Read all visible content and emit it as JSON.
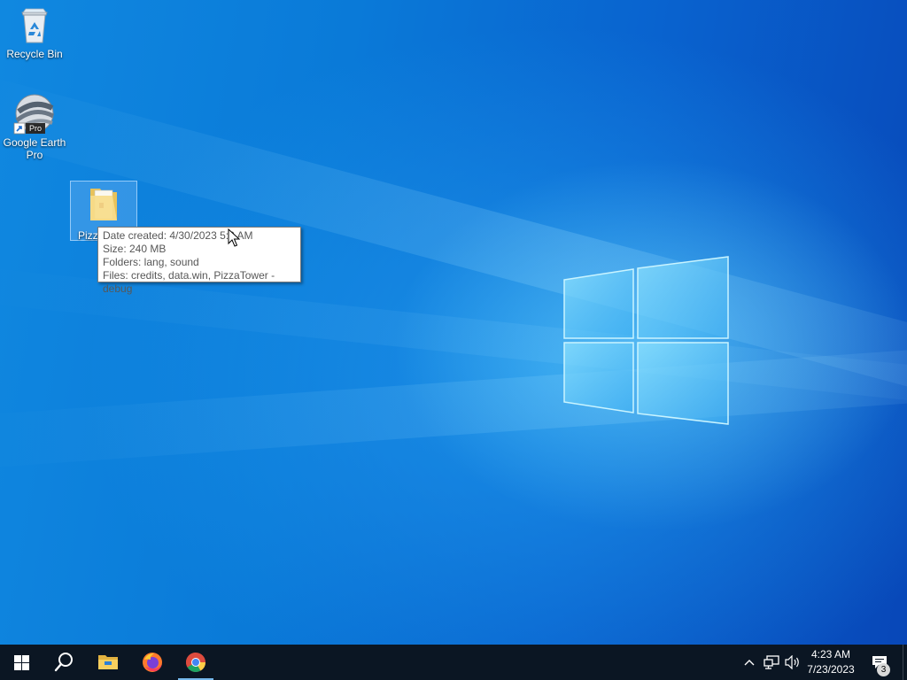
{
  "desktop": {
    "icons": [
      {
        "label": "Recycle Bin"
      },
      {
        "label": "Google Earth Pro",
        "badge": "Pro"
      },
      {
        "label": "Pizza"
      }
    ],
    "tooltip": {
      "date_created": "Date created: 4/30/2023 5:2 AM",
      "size": "Size: 240 MB",
      "folders": "Folders: lang, sound",
      "files": "Files: credits, data.win, PizzaTower -debug"
    }
  },
  "taskbar": {
    "pinned": [
      "start-icon",
      "search-icon",
      "file-explorer-icon",
      "firefox-icon",
      "chrome-icon"
    ],
    "active": "chrome",
    "clock": {
      "time": "4:23 AM",
      "date": "7/23/2023"
    },
    "notifications_count": "3"
  },
  "colors": {
    "taskbar": "#0b1623",
    "accent": "#76b9ed",
    "desktop": "#0a7ad8"
  }
}
